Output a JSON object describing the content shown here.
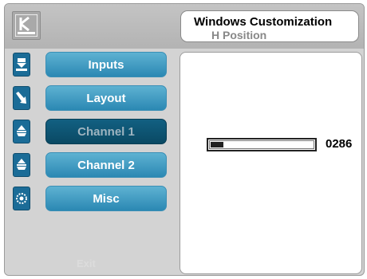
{
  "header": {
    "title": "Windows Customization",
    "subtitle": "H Position",
    "logo_icon": "kramer-logo-icon"
  },
  "menu": {
    "items": [
      {
        "label": "Inputs",
        "icon": "input-icon",
        "active": false
      },
      {
        "label": "Layout",
        "icon": "layout-arrow-icon",
        "active": false
      },
      {
        "label": "Channel 1",
        "icon": "channel-bell-icon",
        "active": true
      },
      {
        "label": "Channel 2",
        "icon": "channel-bell-icon",
        "active": false
      },
      {
        "label": "Misc",
        "icon": "misc-gear-icon",
        "active": false
      }
    ],
    "faded_label": "Exit"
  },
  "control": {
    "value_text": "0286",
    "fill_fraction": 0.12
  },
  "colors": {
    "button": "#3a95bf",
    "button_active": "#0e5677",
    "icon_bg": "#1b6c97"
  }
}
